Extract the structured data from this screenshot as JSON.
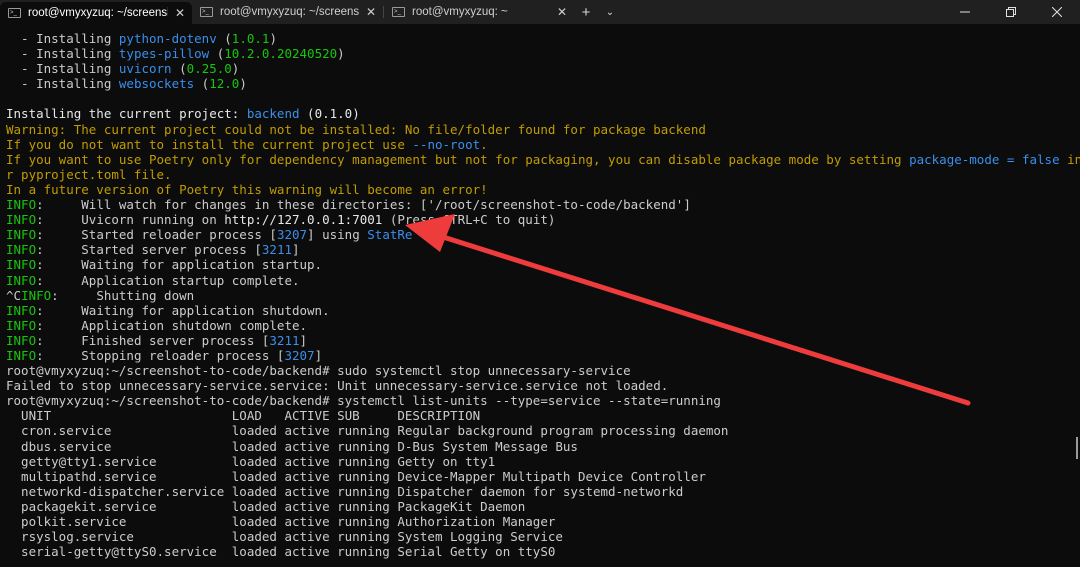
{
  "tabs": [
    {
      "label": "root@vmyxyzuq: ~/screenshc",
      "icon": "terminal-icon"
    },
    {
      "label": "root@vmyxyzuq: ~/screenshot",
      "icon": "terminal-icon"
    },
    {
      "label": "root@vmyxyzuq: ~",
      "icon": "terminal-icon"
    }
  ],
  "colors": {
    "green": "#16c60c",
    "yellow": "#c19c00",
    "blue": "#3b8eea",
    "arrow": "#ee3b3b"
  },
  "lines": [
    [
      {
        "t": "  - Installing "
      },
      {
        "t": "python-dotenv",
        "c": "b"
      },
      {
        "t": " ("
      },
      {
        "t": "1.0.1",
        "c": "g"
      },
      {
        "t": ")"
      }
    ],
    [
      {
        "t": "  - Installing "
      },
      {
        "t": "types-pillow",
        "c": "b"
      },
      {
        "t": " ("
      },
      {
        "t": "10.2.0.20240520",
        "c": "g"
      },
      {
        "t": ")"
      }
    ],
    [
      {
        "t": "  - Installing "
      },
      {
        "t": "uvicorn",
        "c": "b"
      },
      {
        "t": " ("
      },
      {
        "t": "0.25.0",
        "c": "g"
      },
      {
        "t": ")"
      }
    ],
    [
      {
        "t": "  - Installing "
      },
      {
        "t": "websockets",
        "c": "b"
      },
      {
        "t": " ("
      },
      {
        "t": "12.0",
        "c": "g"
      },
      {
        "t": ")"
      }
    ],
    [
      {
        "t": ""
      }
    ],
    [
      {
        "t": "Installing the current project: ",
        "c": "w"
      },
      {
        "t": "backend",
        "c": "b"
      },
      {
        "t": " (",
        "c": "w"
      },
      {
        "t": "0.1.0",
        "c": "w"
      },
      {
        "t": ")",
        "c": "w"
      }
    ],
    [
      {
        "t": "Warning: The current project could not be installed: No file/folder found for package backend",
        "c": "y"
      }
    ],
    [
      {
        "t": "If you do not want to install the current project use ",
        "c": "y"
      },
      {
        "t": "--no-root",
        "c": "b"
      },
      {
        "t": ".",
        "c": "y"
      }
    ],
    [
      {
        "t": "If you want to use Poetry only for dependency management but not for packaging, you can disable package mode by setting ",
        "c": "y"
      },
      {
        "t": "package-mode = false",
        "c": "b"
      },
      {
        "t": " in you",
        "c": "y"
      }
    ],
    [
      {
        "t": "r pyproject.toml file.",
        "c": "y"
      }
    ],
    [
      {
        "t": "In a future version of Poetry this warning will become an error!",
        "c": "y"
      }
    ],
    [
      {
        "t": "INFO",
        "c": "g"
      },
      {
        "t": ":     Will watch for changes in these directories: ['/root/screenshot-to-code/backend']"
      }
    ],
    [
      {
        "t": "INFO",
        "c": "g"
      },
      {
        "t": ":     Uvicorn running on "
      },
      {
        "t": "http://127.0.0.1:7001",
        "c": "w"
      },
      {
        "t": " (Press CTRL+C to quit)"
      }
    ],
    [
      {
        "t": "INFO",
        "c": "g"
      },
      {
        "t": ":     Started reloader process ["
      },
      {
        "t": "3207",
        "c": "b"
      },
      {
        "t": "] using "
      },
      {
        "t": "StatRe",
        "c": "b"
      }
    ],
    [
      {
        "t": "INFO",
        "c": "g"
      },
      {
        "t": ":     Started server process ["
      },
      {
        "t": "3211",
        "c": "b"
      },
      {
        "t": "]"
      }
    ],
    [
      {
        "t": "INFO",
        "c": "g"
      },
      {
        "t": ":     Waiting for application startup."
      }
    ],
    [
      {
        "t": "INFO",
        "c": "g"
      },
      {
        "t": ":     Application startup complete."
      }
    ],
    [
      {
        "t": "^C"
      },
      {
        "t": "INFO",
        "c": "g"
      },
      {
        "t": ":     Shutting down"
      }
    ],
    [
      {
        "t": "INFO",
        "c": "g"
      },
      {
        "t": ":     Waiting for application shutdown."
      }
    ],
    [
      {
        "t": "INFO",
        "c": "g"
      },
      {
        "t": ":     Application shutdown complete."
      }
    ],
    [
      {
        "t": "INFO",
        "c": "g"
      },
      {
        "t": ":     Finished server process ["
      },
      {
        "t": "3211",
        "c": "b"
      },
      {
        "t": "]"
      }
    ],
    [
      {
        "t": "INFO",
        "c": "g"
      },
      {
        "t": ":     Stopping reloader process ["
      },
      {
        "t": "3207",
        "c": "b"
      },
      {
        "t": "]"
      }
    ],
    [
      {
        "t": "root@vmyxyzuq:~/screenshot-to-code/backend# sudo systemctl stop unnecessary-service"
      }
    ],
    [
      {
        "t": "Failed to stop unnecessary-service.service: Unit unnecessary-service.service not loaded."
      }
    ],
    [
      {
        "t": "root@vmyxyzuq:~/screenshot-to-code/backend# systemctl list-units --type=service --state=running"
      }
    ],
    [
      {
        "t": "  UNIT                        LOAD   ACTIVE SUB     DESCRIPTION"
      }
    ],
    [
      {
        "t": "  cron.service                loaded active running Regular background program processing daemon"
      }
    ],
    [
      {
        "t": "  dbus.service                loaded active running D-Bus System Message Bus"
      }
    ],
    [
      {
        "t": "  getty@tty1.service          loaded active running Getty on tty1"
      }
    ],
    [
      {
        "t": "  multipathd.service          loaded active running Device-Mapper Multipath Device Controller"
      }
    ],
    [
      {
        "t": "  networkd-dispatcher.service loaded active running Dispatcher daemon for systemd-networkd"
      }
    ],
    [
      {
        "t": "  packagekit.service          loaded active running PackageKit Daemon"
      }
    ],
    [
      {
        "t": "  polkit.service              loaded active running Authorization Manager"
      }
    ],
    [
      {
        "t": "  rsyslog.service             loaded active running System Logging Service"
      }
    ],
    [
      {
        "t": "  serial-getty@ttyS0.service  loaded active running Serial Getty on ttyS0"
      }
    ]
  ]
}
